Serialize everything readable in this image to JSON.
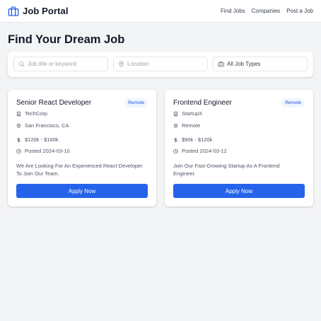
{
  "header": {
    "title": "Job Portal",
    "logo_icon": "briefcase-icon",
    "nav": [
      "Find Jobs",
      "Companies",
      "Post a Job"
    ]
  },
  "page_title": "Find Your Dream Job",
  "search": {
    "keyword_placeholder": "Job title or keyword",
    "location_placeholder": "Location",
    "job_type_value": "All Job Types"
  },
  "jobs": [
    {
      "title": "Senior React Developer",
      "badge": "Remote",
      "company": "TechCorp",
      "location": "San Francisco, CA",
      "salary": "$120k - $160k",
      "posted": "Posted 2024-03-10",
      "description": "We Are Looking For An Experienced React Developer To Join Our Team.",
      "apply_label": "Apply Now"
    },
    {
      "title": "Frontend Engineer",
      "badge": "Remote",
      "company": "StartupX",
      "location": "Remote",
      "salary": "$90k - $120k",
      "posted": "Posted 2024-03-12",
      "description": "Join Our Fast-Growing Startup As A Frontend Engineer.",
      "apply_label": "Apply Now"
    }
  ],
  "colors": {
    "accent": "#2563eb",
    "badge_bg": "#eff6ff",
    "badge_text": "#1d4ed8",
    "background": "#f3f4f6"
  }
}
